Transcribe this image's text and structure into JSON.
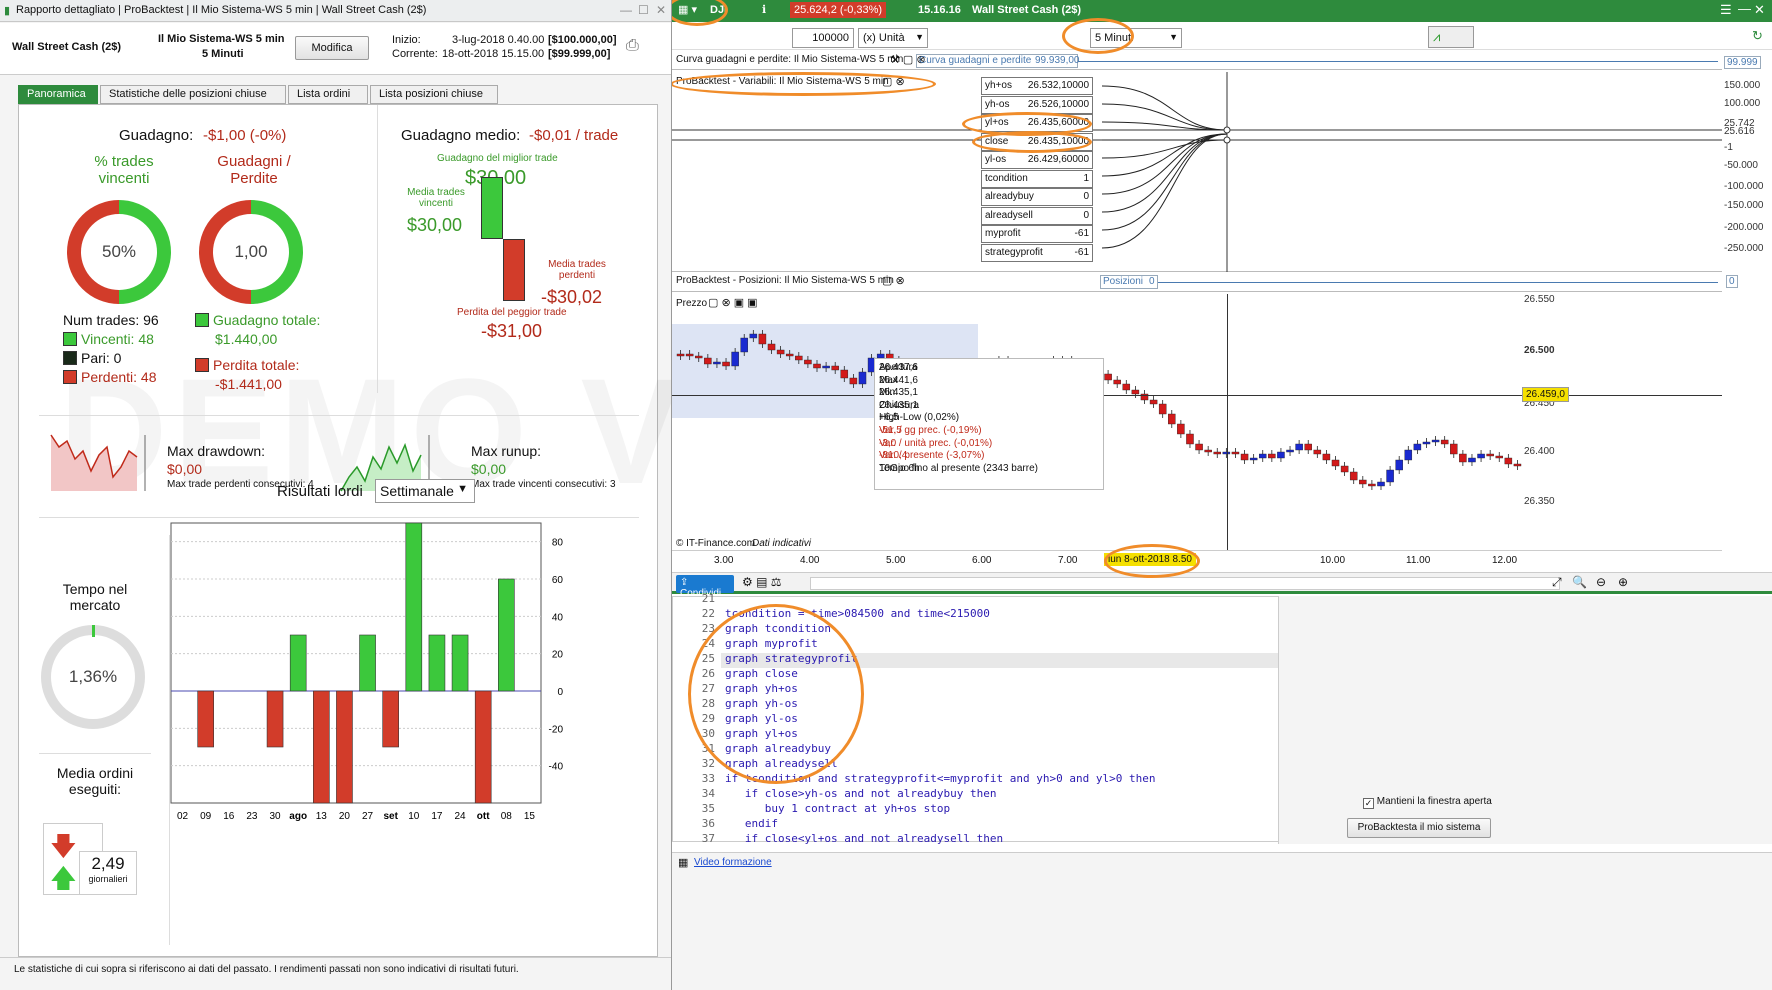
{
  "left": {
    "window_title": "Rapporto dettagliato | ProBacktest | Il Mio Sistema-WS 5 min | Wall Street Cash (2$)",
    "instrument": "Wall Street Cash (2$)",
    "system_name": "Il Mio Sistema-WS 5 min",
    "system_tf": "5 Minuti",
    "modify_btn": "Modifica",
    "start_label": "Inizio:",
    "start_date": "3-lug-2018 0.40.00",
    "start_capital": "[$100.000,00]",
    "current_label": "Corrente:",
    "current_date": "18-ott-2018 15.15.00",
    "current_capital": "[$99.999,00]",
    "tabs": [
      "Panoramica",
      "Statistiche delle posizioni chiuse",
      "Lista ordini",
      "Lista posizioni chiuse"
    ],
    "gain_label": "Guadagno:",
    "gain_value": "-$1,00 (-0%)",
    "pct_trades_title": "% trades vincenti",
    "pct_trades_value": "50%",
    "pct_win": 0.5,
    "gp_title": "Guadagni / Perdite",
    "gp_value": "1,00",
    "num_trades": "Num trades: 96",
    "winners": "Vincenti: 48",
    "even": "Pari: 0",
    "losers": "Perdenti: 48",
    "total_gain_label": "Guadagno totale:",
    "total_gain": "$1.440,00",
    "total_loss_label": "Perdita totale:",
    "total_loss": "-$1.441,00",
    "avg_gain_label": "Guadagno medio:",
    "avg_gain": "-$0,01 / trade",
    "best_trade_label": "Guadagno del miglior trade",
    "best_trade": "$30,00",
    "avg_win_label": "Media trades vincenti",
    "avg_win": "$30,00",
    "avg_loss_label": "Media trades perdenti",
    "avg_loss": "-$30,02",
    "worst_trade_label": "Perdita del peggior trade",
    "worst_trade": "-$31,00",
    "max_dd_label": "Max drawdown:",
    "max_dd": "$0,00",
    "max_loss_consec": "Max trade perdenti consecutivi:  4",
    "max_ru_label": "Max runup:",
    "max_ru": "$0,00",
    "max_win_consec": "Max trade vincenti consecutivi:  3",
    "time_in_market_label": "Tempo nel mercato",
    "time_in_market": "1,36%",
    "avg_orders_label": "Media ordini eseguiti:",
    "avg_orders": "2,49",
    "avg_orders_unit": "giornalieri",
    "results_label": "Risultati lordi",
    "results_period": "Settimanale",
    "footer": "Le statistiche di cui sopra si riferiscono ai dati del passato. I rendimenti passati non sono indicativi di risultati futuri.",
    "watermark": "DEMO VERSION"
  },
  "chart_data": {
    "type": "bar",
    "categories": [
      "02",
      "09",
      "16",
      "23",
      "30",
      "ago",
      "13",
      "20",
      "27",
      "set",
      "10",
      "17",
      "24",
      "ott",
      "08",
      "15"
    ],
    "values": [
      0,
      -30,
      0,
      0,
      -30,
      30,
      -60,
      -60,
      30,
      -30,
      90,
      30,
      30,
      -60,
      60,
      0
    ],
    "ylim": [
      -60,
      90
    ],
    "yticks": [
      80,
      60,
      40,
      20,
      0,
      -20,
      -40
    ],
    "colors": {
      "pos": "#3cc83c",
      "neg": "#d23c2a"
    }
  },
  "right": {
    "symbol": "DJI",
    "price": "25.624,2 (-0,33%)",
    "time": "15.16.16",
    "instrument": "Wall Street Cash (2$)",
    "qty": "100000",
    "unit": "(x) Unità",
    "timeframe": "5 Minuti",
    "equity_label": "Curva guadagni e perdite: Il Mio Sistema-WS 5 min",
    "equity_box": "Curva guadagni e perdite",
    "equity_val": "99.939,00",
    "equity_axis": "99.999",
    "vars_label": "ProBacktest - Variabili: Il Mio Sistema-WS 5 min",
    "vars": [
      {
        "n": "yh+os",
        "v": "26.532,10000"
      },
      {
        "n": "yh-os",
        "v": "26.526,10000"
      },
      {
        "n": "yl+os",
        "v": "26.435,60000"
      },
      {
        "n": "close",
        "v": "26.435,10000"
      },
      {
        "n": "yl-os",
        "v": "26.429,60000"
      },
      {
        "n": "tcondition",
        "v": "1"
      },
      {
        "n": "alreadybuy",
        "v": "0"
      },
      {
        "n": "alreadysell",
        "v": "0"
      },
      {
        "n": "myprofit",
        "v": "-61"
      },
      {
        "n": "strategyprofit",
        "v": "-61"
      }
    ],
    "vars_axis": [
      "150.000",
      "100.000",
      "25.742",
      "25.616",
      "-1",
      "-50.000",
      "-100.000",
      "-150.000",
      "-200.000",
      "-250.000"
    ],
    "pos_label": "ProBacktest - Posizioni: Il Mio Sistema-WS 5 min",
    "pos_box": "Posizioni",
    "pos_val": "0",
    "pos_axis": "0",
    "price_label": "Prezzo",
    "price_axis": [
      "26.550",
      "26.500",
      "26.450",
      "26.400",
      "26.350"
    ],
    "price_marker": "26.459,0",
    "info": [
      {
        "k": "Apertura",
        "v": "26.437,6"
      },
      {
        "k": "Max",
        "v": "26.441,6"
      },
      {
        "k": "Min",
        "v": "26.435,1"
      },
      {
        "k": "Chiusura",
        "v": "26.435,1"
      },
      {
        "k": "High-Low (0,02%)",
        "v": "+6,5"
      },
      {
        "k": "Var. / gg prec. (-0,19%)",
        "v": "-51,5"
      },
      {
        "k": "Var. / unità prec. (-0,01%)",
        "v": "-3,0"
      },
      {
        "k": "Var. / presente (-3,07%)",
        "v": "-810,4"
      },
      {
        "k": "Tempo fino al presente (2343 barre)",
        "v": "10Gio 6h"
      }
    ],
    "copyright": "© IT-Finance.com",
    "data_note": "Dati indicativi",
    "xaxis": [
      "3.00",
      "4.00",
      "5.00",
      "6.00",
      "7.00",
      "8.00",
      "10.00",
      "11.00",
      "12.00"
    ],
    "cursor_time": "lun 8-ott-2018 8.50",
    "share": "Condividi",
    "code": [
      {
        "n": "21",
        "t": ""
      },
      {
        "n": "22",
        "t": "tcondition = time>084500 and time<215000"
      },
      {
        "n": "23",
        "t": "graph tcondition"
      },
      {
        "n": "24",
        "t": "graph myprofit"
      },
      {
        "n": "25",
        "t": "graph strategyprofit"
      },
      {
        "n": "26",
        "t": "graph close"
      },
      {
        "n": "27",
        "t": "graph yh+os"
      },
      {
        "n": "28",
        "t": "graph yh-os"
      },
      {
        "n": "29",
        "t": "graph yl-os"
      },
      {
        "n": "30",
        "t": "graph yl+os"
      },
      {
        "n": "31",
        "t": "graph alreadybuy"
      },
      {
        "n": "32",
        "t": "graph alreadysell"
      },
      {
        "n": "33",
        "t": "if tcondition and strategyprofit<=myprofit and yh>0 and yl>0 then"
      },
      {
        "n": "34",
        "t": "   if close>yh-os and not alreadybuy then"
      },
      {
        "n": "35",
        "t": "      buy 1 contract at yh+os stop"
      },
      {
        "n": "36",
        "t": "   endif"
      },
      {
        "n": "37",
        "t": "   if close<yl+os and not alreadysell then"
      }
    ],
    "keep_open": "Mantieni la finestra aperta",
    "backtest_btn": "ProBacktesta il mio sistema",
    "video": "Video formazione"
  }
}
